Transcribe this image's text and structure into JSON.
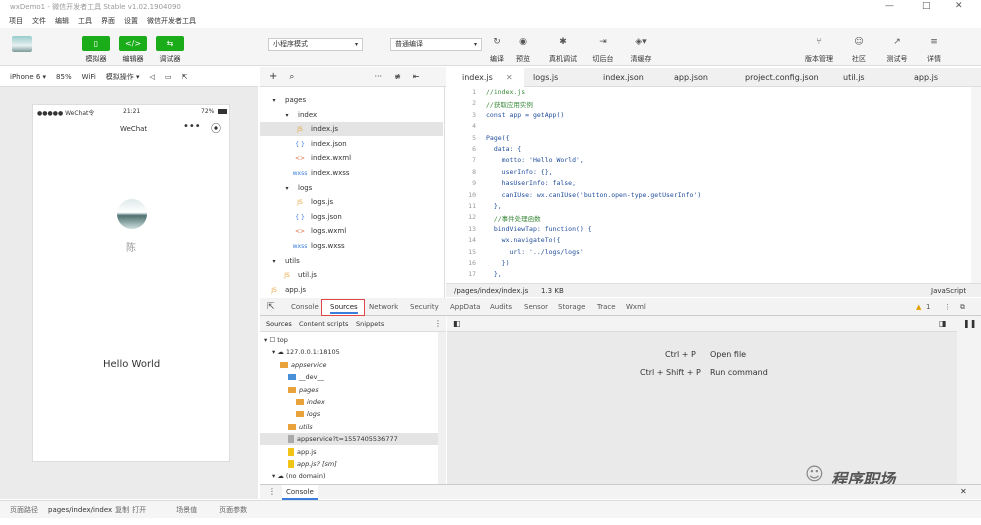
{
  "window": {
    "title": "wxDemo1 - 微信开发者工具 Stable v1.02.1904090"
  },
  "menu": [
    "项目",
    "文件",
    "编辑",
    "工具",
    "界面",
    "设置",
    "微信开发者工具"
  ],
  "toolbar": {
    "simulator": "模拟器",
    "editor": "编辑器",
    "debugger": "调试器",
    "mode": "小程序模式",
    "compile_mode": "普通编译",
    "compile": "编译",
    "preview": "预览",
    "remote_debug": "真机调试",
    "backstage": "切后台",
    "clear_cache": "清缓存",
    "version": "版本管理",
    "community": "社区",
    "test": "测试号",
    "details": "详情"
  },
  "simbar": {
    "device": "iPhone 6 ▾",
    "zoom": "85%",
    "network": "WiFi",
    "action": "模拟操作 ▾"
  },
  "phone": {
    "carrier": "●●●●● WeChat令",
    "time": "21:21",
    "battery": "72%",
    "nav_title": "WeChat",
    "nickname": "陈",
    "motto": "Hello World"
  },
  "filetree": {
    "rows": [
      {
        "label": "pages",
        "kind": "folder",
        "indent": 0
      },
      {
        "label": "index",
        "kind": "folder",
        "indent": 1
      },
      {
        "label": "index.js",
        "kind": "js",
        "indent": 2
      },
      {
        "label": "index.json",
        "kind": "json",
        "indent": 2
      },
      {
        "label": "index.wxml",
        "kind": "wxml",
        "indent": 2
      },
      {
        "label": "index.wxss",
        "kind": "wxss",
        "indent": 2
      },
      {
        "label": "logs",
        "kind": "folder",
        "indent": 1
      },
      {
        "label": "logs.js",
        "kind": "js",
        "indent": 2
      },
      {
        "label": "logs.json",
        "kind": "json",
        "indent": 2
      },
      {
        "label": "logs.wxml",
        "kind": "wxml",
        "indent": 2
      },
      {
        "label": "logs.wxss",
        "kind": "wxss",
        "indent": 2
      },
      {
        "label": "utils",
        "kind": "folder",
        "indent": 0
      },
      {
        "label": "util.js",
        "kind": "js",
        "indent": 1
      },
      {
        "label": "app.js",
        "kind": "js",
        "indent": 0
      }
    ]
  },
  "tabs": [
    "index.js",
    "logs.js",
    "index.json",
    "app.json",
    "project.config.json",
    "util.js",
    "app.js"
  ],
  "code": [
    "//index.js",
    "//获取应用实例",
    "const app = getApp()",
    "",
    "Page({",
    "  data: {",
    "    motto: 'Hello World',",
    "    userInfo: {},",
    "    hasUserInfo: false,",
    "    canIUse: wx.canIUse('button.open-type.getUserInfo')",
    "  },",
    "  //事件处理函数",
    "  bindViewTap: function() {",
    "    wx.navigateTo({",
    "      url: '../logs/logs'",
    "    })",
    "  },"
  ],
  "codestatus": {
    "path": "/pages/index/index.js",
    "size": "1.3 KB",
    "lang": "JavaScript"
  },
  "devtools": {
    "tabs": [
      "Console",
      "Sources",
      "Network",
      "Security",
      "AppData",
      "Audits",
      "Sensor",
      "Storage",
      "Trace",
      "Wxml"
    ],
    "warn": "1",
    "subtabs": [
      "Sources",
      "Content scripts",
      "Snippets"
    ]
  },
  "srctree": [
    {
      "label": "top",
      "indent": 0,
      "icon": "box"
    },
    {
      "label": "127.0.0.1:18105",
      "indent": 1,
      "icon": "cloud"
    },
    {
      "label": "appservice",
      "indent": 2,
      "icon": "fold"
    },
    {
      "label": "__dev__",
      "indent": 3,
      "icon": "folb"
    },
    {
      "label": "pages",
      "indent": 3,
      "icon": "fold"
    },
    {
      "label": "index",
      "indent": 4,
      "icon": "fold"
    },
    {
      "label": "logs",
      "indent": 4,
      "icon": "fold"
    },
    {
      "label": "utils",
      "indent": 3,
      "icon": "fold"
    },
    {
      "label": "appservice?t=1557405536777",
      "indent": 3,
      "icon": "filg"
    },
    {
      "label": "app.js",
      "indent": 3,
      "icon": "fily"
    },
    {
      "label": "app.js? [sm]",
      "indent": 3,
      "icon": "fily"
    },
    {
      "label": "(no domain)",
      "indent": 1,
      "icon": "cloud"
    }
  ],
  "shortcuts": [
    {
      "keys": "Ctrl + P",
      "action": "Open file"
    },
    {
      "keys": "Ctrl + Shift + P",
      "action": "Run command"
    }
  ],
  "console": "Console",
  "statusbar": {
    "path_label": "页面路径",
    "path": "pages/index/index",
    "copy": "复制",
    "open": "打开",
    "scene": "场景值",
    "params": "页面参数"
  },
  "watermark": "程序职场"
}
